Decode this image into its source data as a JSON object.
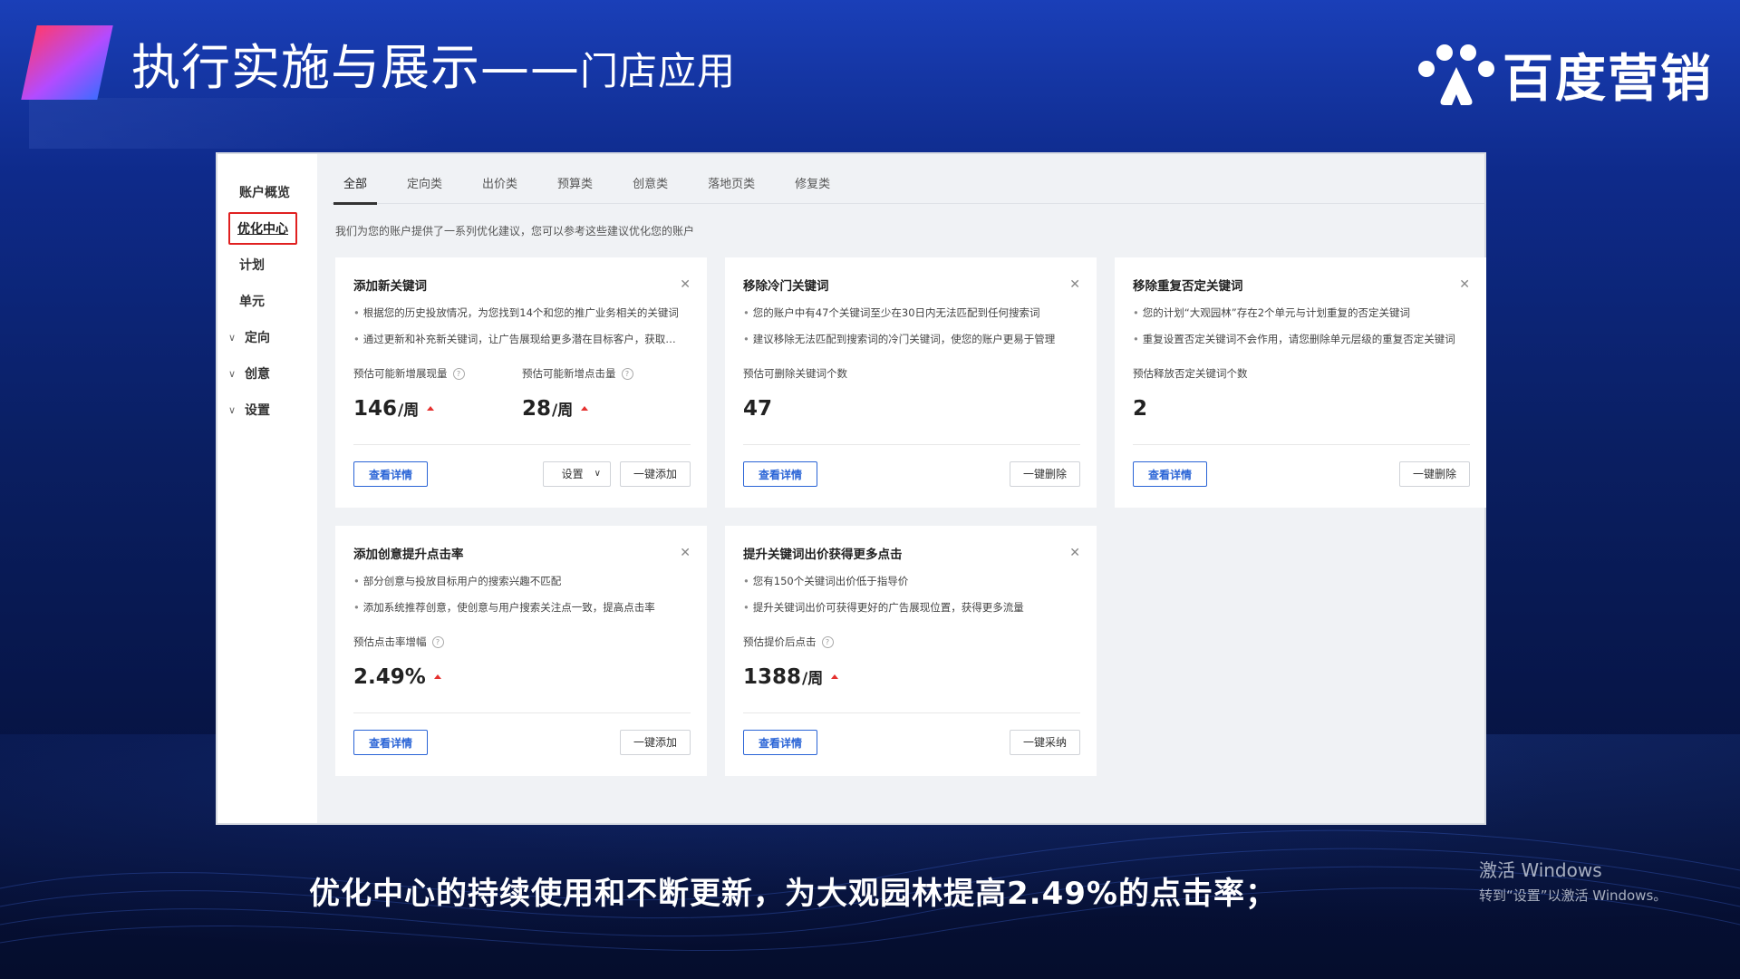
{
  "header": {
    "title_main": "执行实施与展示——",
    "title_sub": "门店应用",
    "brand_name": "百度营销",
    "accent_gradient": [
      "#ff3a6e",
      "#b34bff",
      "#3f6bff"
    ]
  },
  "sidebar": {
    "items": [
      {
        "label": "账户概览",
        "arrow": false,
        "active": false
      },
      {
        "label": "优化中心",
        "arrow": false,
        "active": true
      },
      {
        "label": "计划",
        "arrow": false,
        "active": false
      },
      {
        "label": "单元",
        "arrow": false,
        "active": false
      },
      {
        "label": "定向",
        "arrow": true,
        "active": false
      },
      {
        "label": "创意",
        "arrow": true,
        "active": false
      },
      {
        "label": "设置",
        "arrow": true,
        "active": false
      }
    ]
  },
  "tabs": [
    {
      "label": "全部",
      "active": true
    },
    {
      "label": "定向类",
      "active": false
    },
    {
      "label": "出价类",
      "active": false
    },
    {
      "label": "预算类",
      "active": false
    },
    {
      "label": "创意类",
      "active": false
    },
    {
      "label": "落地页类",
      "active": false
    },
    {
      "label": "修复类",
      "active": false
    }
  ],
  "hint": "我们为您的账户提供了一系列优化建议，您可以参考这些建议优化您的账户",
  "cards": [
    {
      "title": "添加新关键词",
      "bullets": [
        "根据您的历史投放情况，为您找到14个和您的推广业务相关的关键词",
        "通过更新和补充新关键词，让广告展现给更多潜在目标客户，获取更多流量"
      ],
      "metrics": [
        {
          "label": "预估可能新增展现量",
          "value": "146",
          "unit": "/周",
          "info": true,
          "up": true
        },
        {
          "label": "预估可能新增点击量",
          "value": "28",
          "unit": "/周",
          "info": true,
          "up": true
        }
      ],
      "primary": "查看详情",
      "select": "设置",
      "secondary": "一键添加"
    },
    {
      "title": "移除冷门关键词",
      "bullets": [
        "您的账户中有47个关键词至少在30日内无法匹配到任何搜索词",
        "建议移除无法匹配到搜索词的冷门关键词，使您的账户更易于管理"
      ],
      "metrics": [
        {
          "label": "预估可删除关键词个数",
          "value": "47",
          "unit": "",
          "info": false,
          "up": false
        }
      ],
      "primary": "查看详情",
      "select": "",
      "secondary": "一键删除"
    },
    {
      "title": "移除重复否定关键词",
      "bullets": [
        "您的计划“大观园林”存在2个单元与计划重复的否定关键词",
        "重复设置否定关键词不会作用，请您删除单元层级的重复否定关键词"
      ],
      "metrics": [
        {
          "label": "预估释放否定关键词个数",
          "value": "2",
          "unit": "",
          "info": false,
          "up": false
        }
      ],
      "primary": "查看详情",
      "select": "",
      "secondary": "一键删除"
    },
    {
      "title": "添加创意提升点击率",
      "bullets": [
        "部分创意与投放目标用户的搜索兴趣不匹配",
        "添加系统推荐创意，使创意与用户搜索关注点一致，提高点击率"
      ],
      "metrics": [
        {
          "label": "预估点击率增幅",
          "value": "2.49%",
          "unit": "",
          "info": true,
          "up": true
        }
      ],
      "primary": "查看详情",
      "select": "",
      "secondary": "一键添加"
    },
    {
      "title": "提升关键词出价获得更多点击",
      "bullets": [
        "您有150个关键词出价低于指导价",
        "提升关键词出价可获得更好的广告展现位置，获得更多流量"
      ],
      "metrics": [
        {
          "label": "预估提价后点击",
          "value": "1388",
          "unit": "/周",
          "info": true,
          "up": true
        }
      ],
      "primary": "查看详情",
      "select": "",
      "secondary": "一键采纳"
    }
  ],
  "caption": "优化中心的持续使用和不断更新，为大观园林提高2.49%的点击率；",
  "watermark": {
    "line1": "激活 Windows",
    "line2": "转到“设置”以激活 Windows。"
  },
  "icons": {
    "close": "close-icon",
    "info": "info-icon",
    "up": "arrow-up-icon",
    "chevron": "chevron-down-icon"
  },
  "colors": {
    "primary_blue": "#2a64d6",
    "up_red": "#e5312f",
    "active_outline": "#e02020"
  }
}
